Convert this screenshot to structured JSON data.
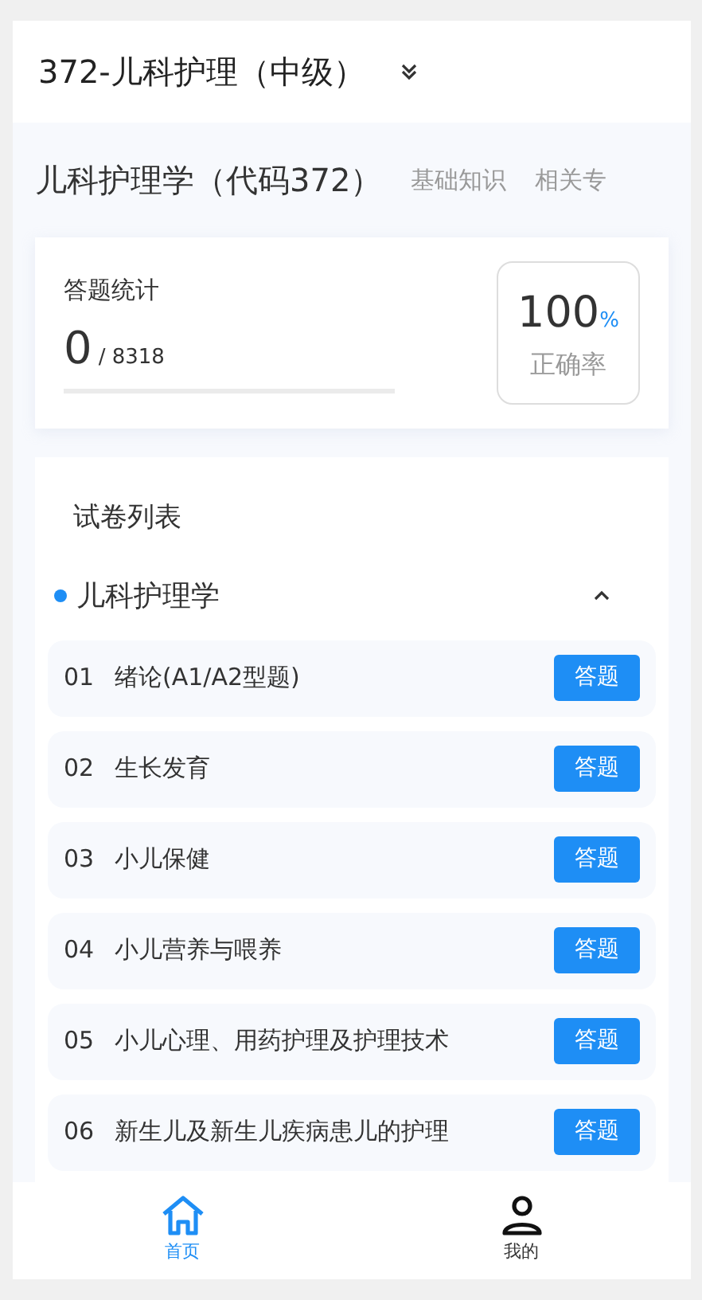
{
  "header": {
    "title": "372-儿科护理（中级）"
  },
  "subject": {
    "title": "儿科护理学（代码372）",
    "tabs": [
      {
        "label": "基础知识",
        "selected": false
      },
      {
        "label": "相关专",
        "selected": false
      }
    ]
  },
  "stats": {
    "label": "答题统计",
    "answered": "0",
    "total": "/ 8318",
    "level": 0,
    "rate": "100",
    "rate_unit": "%",
    "rate_label": "正确率"
  },
  "papers": {
    "title": "试卷列表",
    "group": {
      "name": "儿科护理学",
      "expanded": true,
      "color": "#1e8ef5"
    },
    "items": [
      {
        "number": "01",
        "name": "绪论(A1/A2型题)",
        "action": "答题"
      },
      {
        "number": "02",
        "name": "生长发育",
        "action": "答题"
      },
      {
        "number": "03",
        "name": "小儿保健",
        "action": "答题"
      },
      {
        "number": "04",
        "name": "小儿营养与喂养",
        "action": "答题"
      },
      {
        "number": "05",
        "name": "小儿心理、用药护理及护理技术",
        "action": "答题"
      },
      {
        "number": "06",
        "name": "新生儿及新生儿疾病患儿的护理",
        "action": "答题"
      }
    ]
  },
  "tabbar": [
    {
      "label": "首页",
      "kind": "home",
      "selected": true
    },
    {
      "label": "我的",
      "kind": "profile",
      "selected": false
    }
  ]
}
